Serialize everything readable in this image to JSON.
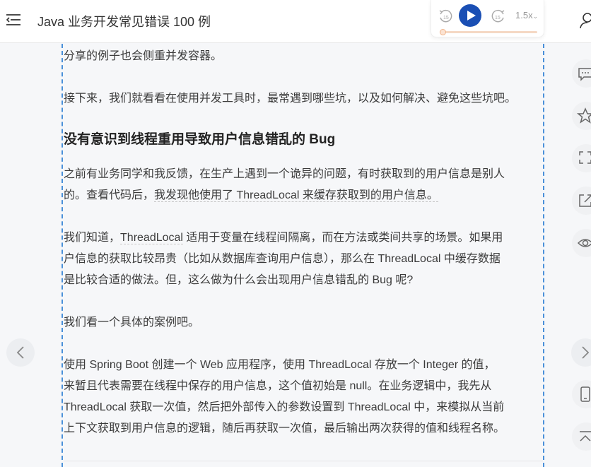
{
  "header": {
    "title": "Java 业务开发常见错误 100 例"
  },
  "player": {
    "rewind_label": "15",
    "forward_label": "15",
    "speed_label": "1.5x",
    "progress": 0.02
  },
  "article": {
    "p1": "分享的例子也会侧重并发容器。",
    "p2": "接下来，我们就看看在使用并发工具时，最常遇到哪些坑，以及如何解决、避免这些坑吧。",
    "heading": "没有意识到线程重用导致用户信息错乱的 Bug",
    "p3_line1": "之前有业务同学和我反馈，在生产上遇到一个诡异的问题，有时获取到的用户信息是别人",
    "p3_line2a": "的。查看代码后，",
    "p3_line2b": "我发现他使用了 ThreadLocal 来缓存获取到的用户信息。",
    "p4_line1a": "我们知道，",
    "p4_line1b": "ThreadLocal",
    "p4_line1c": " 适用于变量在线程间隔离，而在方法或类间共享的场景。如果用",
    "p4_line2": "户信息的获取比较昂贵（比如从数据库查询用户信息），那么在 ThreadLocal 中缓存数据",
    "p4_line3": "是比较合适的做法。但，这么做为什么会出现用户信息错乱的 Bug 呢?",
    "p5": "我们看一个具体的案例吧。",
    "p6_line1": "使用 Spring Boot 创建一个 Web 应用程序，使用 ThreadLocal 存放一个 Integer 的值，",
    "p6_line2": "来暂且代表需要在线程中保存的用户信息，这个值初始是 null。在业务逻辑中，我先从",
    "p6_line3": "ThreadLocal 获取一次值，然后把外部传入的参数设置到 ThreadLocal 中，来模拟从当前",
    "p6_line4": "上下文获取到用户信息的逻辑，随后再获取一次值，最后输出两次获得的值和线程名称。"
  },
  "icons": {
    "menu": "menu-icon",
    "rewind": "rewind-15-icon",
    "play": "play-icon",
    "forward": "forward-15-icon",
    "user": "user-icon",
    "prev": "chevron-left-icon",
    "next": "chevron-right-icon",
    "comment": "comment-icon",
    "star": "star-icon",
    "fullscreen": "fullscreen-icon",
    "share": "share-icon",
    "eye": "eye-icon",
    "mobile": "mobile-icon",
    "top": "back-to-top-icon"
  },
  "colors": {
    "accent_blue": "#1a4fb4",
    "dashed_border": "#4a90d9",
    "progress_orange": "#f1a36a"
  }
}
